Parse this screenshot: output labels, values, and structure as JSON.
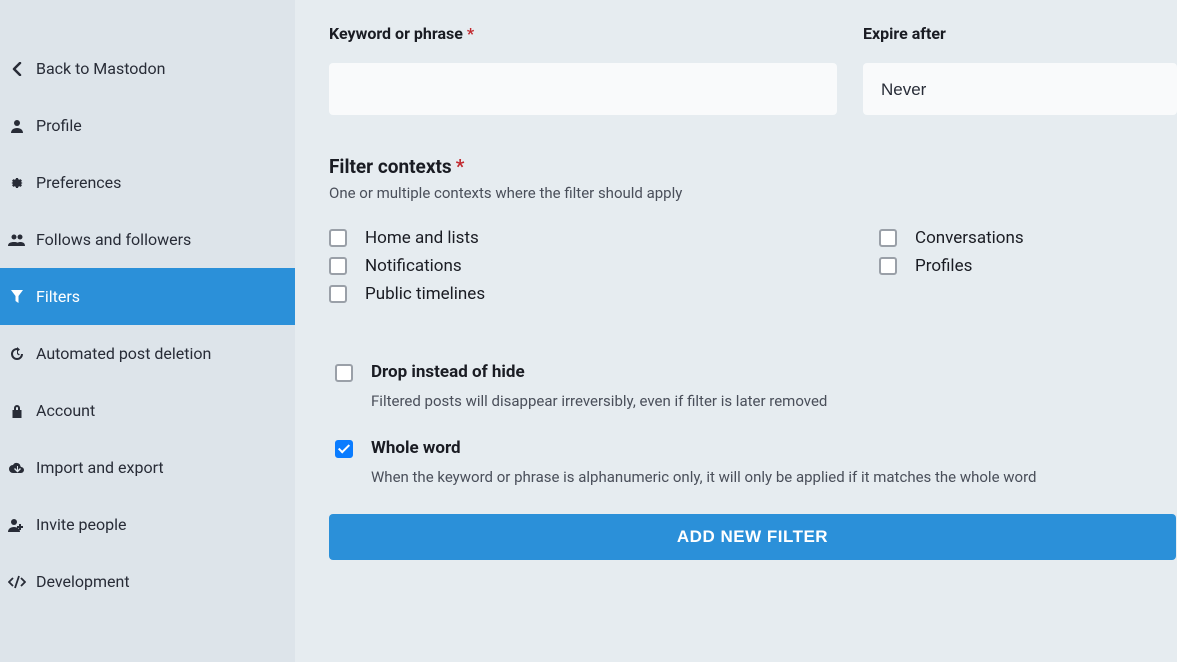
{
  "sidebar": {
    "items": [
      {
        "label": "Back to Mastodon",
        "icon": "chevron-left-icon"
      },
      {
        "label": "Profile",
        "icon": "user-icon"
      },
      {
        "label": "Preferences",
        "icon": "gear-icon"
      },
      {
        "label": "Follows and followers",
        "icon": "users-icon"
      },
      {
        "label": "Filters",
        "icon": "filter-icon",
        "active": true
      },
      {
        "label": "Automated post deletion",
        "icon": "history-icon"
      },
      {
        "label": "Account",
        "icon": "lock-icon"
      },
      {
        "label": "Import and export",
        "icon": "cloud-download-icon"
      },
      {
        "label": "Invite people",
        "icon": "user-plus-icon"
      },
      {
        "label": "Development",
        "icon": "code-icon"
      }
    ]
  },
  "form": {
    "keyword": {
      "label": "Keyword or phrase",
      "required": "*",
      "value": ""
    },
    "expire": {
      "label": "Expire after",
      "value": "Never"
    },
    "contexts": {
      "title": "Filter contexts",
      "required": "*",
      "subtitle": "One or multiple contexts where the filter should apply",
      "col1": [
        {
          "label": "Home and lists",
          "checked": false
        },
        {
          "label": "Notifications",
          "checked": false
        },
        {
          "label": "Public timelines",
          "checked": false
        }
      ],
      "col2": [
        {
          "label": "Conversations",
          "checked": false
        },
        {
          "label": "Profiles",
          "checked": false
        }
      ]
    },
    "drop": {
      "label": "Drop instead of hide",
      "desc": "Filtered posts will disappear irreversibly, even if filter is later removed",
      "checked": false
    },
    "whole": {
      "label": "Whole word",
      "desc": "When the keyword or phrase is alphanumeric only, it will only be applied if it matches the whole word",
      "checked": true
    },
    "submit": "Add new filter"
  }
}
